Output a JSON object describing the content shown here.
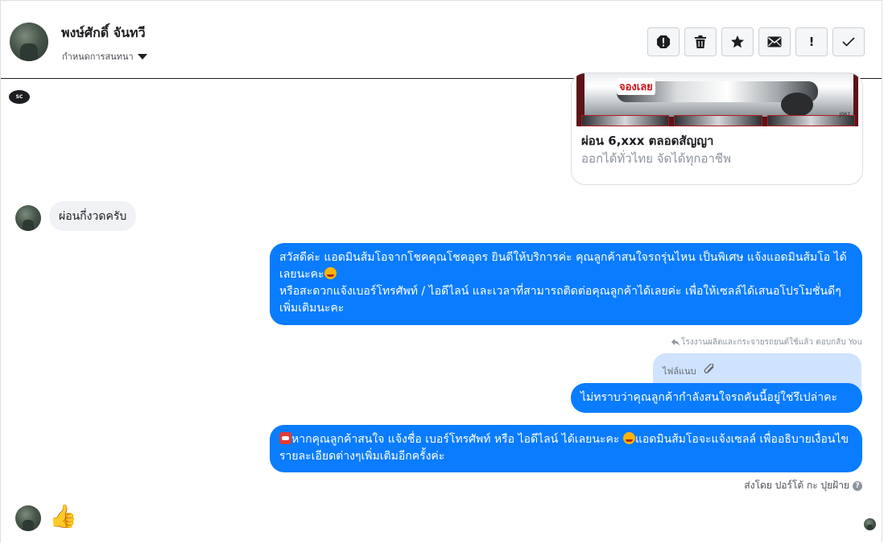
{
  "header": {
    "contact_name": "พงษ์ศักดิ์ จันทวี",
    "assign_label": "กำหนดการสนทนา",
    "actions": [
      {
        "name": "report-icon",
        "label": "report"
      },
      {
        "name": "trash-icon",
        "label": "delete"
      },
      {
        "name": "star-icon",
        "label": "star"
      },
      {
        "name": "envelope-icon",
        "label": "mark-unread"
      },
      {
        "name": "exclamation-icon",
        "label": "!"
      },
      {
        "name": "check-icon",
        "label": "done"
      }
    ],
    "exclamation_text": "!"
  },
  "card": {
    "stamp_text": "จองเลย",
    "code_text": "J067",
    "title": "ผ่อน 6,xxx ตลอดสัญญา",
    "subtitle": "ออกได้ทั่วไทย จัดได้ทุกอาชีพ"
  },
  "messages": {
    "incoming_1": "ผ่อนกี่งวดครับ",
    "outgoing_1": {
      "line1": "สวัสดีค่ะ แอดมินส้มโอจากโชคคุณโชคอุดร ยินดีให้บริการค่ะ   คุณลูกค้าสนใจรถรุ่นไหน เป็นพิเศษ แจ้งแอดมินส้มโอ ได้เลยนะคะ",
      "line2": "หรือสะดวกแจ้งเบอร์โทรศัพท์ / ไอดีไลน์ และเวลาที่สามารถติดต่อคุณลูกค้าได้เลยค่ะ เพื่อให้เซลล์ได้เสนอโปรโมชั่นดีๆเพิ่มเติมนะคะ"
    },
    "reply_note": "โรงงานผลิตและกระจายรถยนต์ใช้แล้ว ตอบกลับ You",
    "reply_quote": "ไฟล์แนบ",
    "outgoing_2": "ไม่ทราบว่าคุณลูกค้ากำลังสนใจรถคันนี้อยู่ใช่รึเปล่าคะ",
    "outgoing_3": {
      "part1": "หากคุณลูกค้าสนใจ แจ้งชื่อ เบอร์โทรศัพท์ หรือ ไอดีไลน์  ได้เลยนะคะ ",
      "part2": "แอดมินส้มโอจะแจ้งเซลล์   เพื่ออธิบายเงื่อนไขรายละเอียดต่างๆเพิ่มเติมอีกครั้งค่ะ"
    },
    "sent_by": "ส่งโดย ปอร์โต้ กะ ปุยฝ้าย",
    "help_glyph": "?",
    "last_incoming_emoji": "👍"
  },
  "logo_text": "SC",
  "colors": {
    "accent": "#0a7cff",
    "incoming_bg": "#f0f2f5",
    "reply_bg": "#cfe3ff"
  }
}
